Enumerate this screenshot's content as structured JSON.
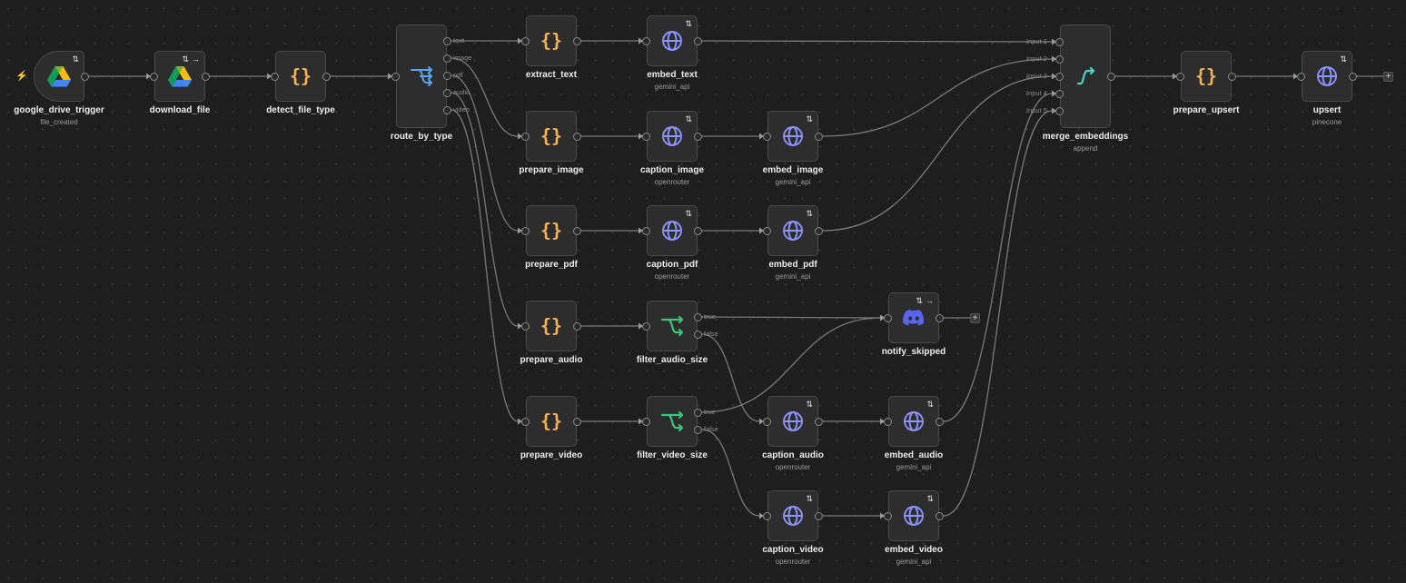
{
  "colors": {
    "code": "#f0b25a",
    "http": "#8d94ff",
    "router": "#59a6f0",
    "filter": "#3fc27a",
    "merge": "#4fd1c5",
    "discord": "#5865f2",
    "edge": "#7a7a7a"
  },
  "nodes": [
    {
      "id": "google_drive_trigger",
      "title": "google_drive_trigger",
      "subtitle": "file_created",
      "icon": "google-drive-icon",
      "badges": [
        "⇅"
      ]
    },
    {
      "id": "download_file",
      "title": "download_file",
      "subtitle": "",
      "icon": "google-drive-icon",
      "badges": [
        "⇅",
        "→"
      ]
    },
    {
      "id": "detect_file_type",
      "title": "detect_file_type",
      "subtitle": "",
      "icon": "code-braces-icon",
      "badges": []
    },
    {
      "id": "route_by_type",
      "title": "route_by_type",
      "subtitle": "",
      "icon": "router-icon",
      "badges": [],
      "outputs": [
        "text",
        "image",
        "pdf",
        "audio",
        "video"
      ]
    },
    {
      "id": "extract_text",
      "title": "extract_text",
      "subtitle": "",
      "icon": "code-braces-icon",
      "badges": []
    },
    {
      "id": "embed_text",
      "title": "embed_text",
      "subtitle": "gemini_api",
      "icon": "globe-icon",
      "badges": [
        "⇅"
      ]
    },
    {
      "id": "prepare_image",
      "title": "prepare_image",
      "subtitle": "",
      "icon": "code-braces-icon",
      "badges": []
    },
    {
      "id": "caption_image",
      "title": "caption_image",
      "subtitle": "openrouter",
      "icon": "globe-icon",
      "badges": [
        "⇅"
      ]
    },
    {
      "id": "embed_image",
      "title": "embed_image",
      "subtitle": "gemini_api",
      "icon": "globe-icon",
      "badges": [
        "⇅"
      ]
    },
    {
      "id": "prepare_pdf",
      "title": "prepare_pdf",
      "subtitle": "",
      "icon": "code-braces-icon",
      "badges": []
    },
    {
      "id": "caption_pdf",
      "title": "caption_pdf",
      "subtitle": "openrouter",
      "icon": "globe-icon",
      "badges": [
        "⇅"
      ]
    },
    {
      "id": "embed_pdf",
      "title": "embed_pdf",
      "subtitle": "gemini_api",
      "icon": "globe-icon",
      "badges": [
        "⇅"
      ]
    },
    {
      "id": "prepare_audio",
      "title": "prepare_audio",
      "subtitle": "",
      "icon": "code-braces-icon",
      "badges": []
    },
    {
      "id": "filter_audio_size",
      "title": "filter_audio_size",
      "subtitle": "",
      "icon": "filter-branch-icon",
      "badges": [],
      "outputs": [
        "true",
        "false"
      ]
    },
    {
      "id": "notify_skipped",
      "title": "notify_skipped",
      "subtitle": "",
      "icon": "discord-icon",
      "badges": [
        "⇅",
        "→"
      ]
    },
    {
      "id": "prepare_video",
      "title": "prepare_video",
      "subtitle": "",
      "icon": "code-braces-icon",
      "badges": []
    },
    {
      "id": "filter_video_size",
      "title": "filter_video_size",
      "subtitle": "",
      "icon": "filter-branch-icon",
      "badges": [],
      "outputs": [
        "true",
        "false"
      ]
    },
    {
      "id": "caption_audio",
      "title": "caption_audio",
      "subtitle": "openrouter",
      "icon": "globe-icon",
      "badges": [
        "⇅"
      ]
    },
    {
      "id": "embed_audio",
      "title": "embed_audio",
      "subtitle": "gemini_api",
      "icon": "globe-icon",
      "badges": [
        "⇅"
      ]
    },
    {
      "id": "caption_video",
      "title": "caption_video",
      "subtitle": "openrouter",
      "icon": "globe-icon",
      "badges": [
        "⇅"
      ]
    },
    {
      "id": "embed_video",
      "title": "embed_video",
      "subtitle": "gemini_api",
      "icon": "globe-icon",
      "badges": [
        "⇅"
      ]
    },
    {
      "id": "merge_embeddings",
      "title": "merge_embeddings",
      "subtitle": "append",
      "icon": "merge-icon",
      "badges": [],
      "inputs": [
        "Input 1",
        "Input 2",
        "Input 3",
        "Input 4",
        "Input 5"
      ]
    },
    {
      "id": "prepare_upsert",
      "title": "prepare_upsert",
      "subtitle": "",
      "icon": "code-braces-icon",
      "badges": []
    },
    {
      "id": "upsert",
      "title": "upsert",
      "subtitle": "pinecone",
      "icon": "globe-icon",
      "badges": [
        "⇅"
      ]
    }
  ],
  "connections": [
    [
      "google_drive_trigger",
      0,
      "download_file",
      0
    ],
    [
      "download_file",
      0,
      "detect_file_type",
      0
    ],
    [
      "detect_file_type",
      0,
      "route_by_type",
      0
    ],
    [
      "route_by_type",
      0,
      "extract_text",
      0
    ],
    [
      "route_by_type",
      1,
      "prepare_image",
      0
    ],
    [
      "route_by_type",
      2,
      "prepare_pdf",
      0
    ],
    [
      "route_by_type",
      3,
      "prepare_audio",
      0
    ],
    [
      "route_by_type",
      4,
      "prepare_video",
      0
    ],
    [
      "extract_text",
      0,
      "embed_text",
      0
    ],
    [
      "prepare_image",
      0,
      "caption_image",
      0
    ],
    [
      "caption_image",
      0,
      "embed_image",
      0
    ],
    [
      "prepare_pdf",
      0,
      "caption_pdf",
      0
    ],
    [
      "caption_pdf",
      0,
      "embed_pdf",
      0
    ],
    [
      "prepare_audio",
      0,
      "filter_audio_size",
      0
    ],
    [
      "filter_audio_size",
      0,
      "notify_skipped",
      0
    ],
    [
      "filter_audio_size",
      1,
      "caption_audio",
      0
    ],
    [
      "prepare_video",
      0,
      "filter_video_size",
      0
    ],
    [
      "filter_video_size",
      0,
      "notify_skipped",
      0
    ],
    [
      "filter_video_size",
      1,
      "caption_video",
      0
    ],
    [
      "caption_audio",
      0,
      "embed_audio",
      0
    ],
    [
      "caption_video",
      0,
      "embed_video",
      0
    ],
    [
      "embed_text",
      0,
      "merge_embeddings",
      0
    ],
    [
      "embed_image",
      0,
      "merge_embeddings",
      1
    ],
    [
      "embed_pdf",
      0,
      "merge_embeddings",
      2
    ],
    [
      "embed_audio",
      0,
      "merge_embeddings",
      3
    ],
    [
      "embed_video",
      0,
      "merge_embeddings",
      4
    ],
    [
      "merge_embeddings",
      0,
      "prepare_upsert",
      0
    ],
    [
      "prepare_upsert",
      0,
      "upsert",
      0
    ]
  ],
  "add_buttons": [
    {
      "after": "notify_skipped",
      "label": "+"
    },
    {
      "after": "upsert",
      "label": "+"
    }
  ],
  "trigger_symbol": "⚡"
}
